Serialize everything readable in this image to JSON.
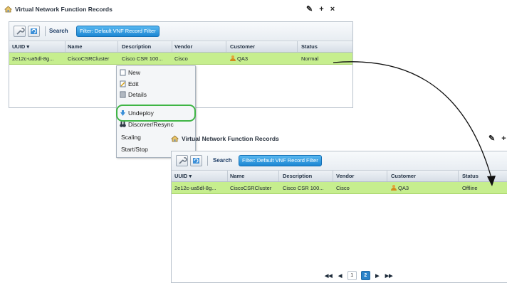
{
  "panel1": {
    "title": "Virtual Network Function Records",
    "tools": "✎ + ×",
    "search_label": "Search",
    "filter_button": "Filter: Default VNF Record Filter",
    "columns": [
      "UUID ▾",
      "Name",
      "Description",
      "Vendor",
      "Customer",
      "Status"
    ],
    "row": {
      "uuid": "2e12c-ua5dl-8g...",
      "name": "CiscoCSRCluster",
      "description": "Cisco CSR 100...",
      "vendor": "Cisco",
      "customer": "QA3",
      "status": "Normal"
    }
  },
  "context_menu": {
    "items": [
      {
        "label": "New",
        "icon": "new-icon"
      },
      {
        "label": "Edit",
        "icon": "edit-icon"
      },
      {
        "label": "Details",
        "icon": "details-icon"
      },
      {
        "label": "Undeploy",
        "icon": "undeploy-icon"
      },
      {
        "label": "Discover/Resync",
        "icon": "binoculars-icon"
      },
      {
        "label": "Scaling",
        "icon": ""
      },
      {
        "label": "Start/Stop",
        "icon": ""
      }
    ],
    "highlight_color": "#3fb545"
  },
  "panel2": {
    "title": "Virtual Network Function Records",
    "tools": "✎ +",
    "search_label": "Search",
    "filter_button": "Filter: Default VNF Record Filter",
    "columns": [
      "UUID ▾",
      "Name",
      "Description",
      "Vendor",
      "Customer",
      "Status"
    ],
    "row": {
      "uuid": "2e12c-ua5dl-8g...",
      "name": "CiscoCSRCluster",
      "description": "Cisco CSR 100...",
      "vendor": "Cisco",
      "customer": "QA3",
      "status": "Offline"
    },
    "pager": {
      "first": "◀◀",
      "prev": "◀",
      "page1": "1",
      "page2": "2",
      "next": "▶",
      "last": "▶▶"
    }
  },
  "colors": {
    "row_selected": "#c6ee8e",
    "filter_button": "#1c86d3"
  }
}
